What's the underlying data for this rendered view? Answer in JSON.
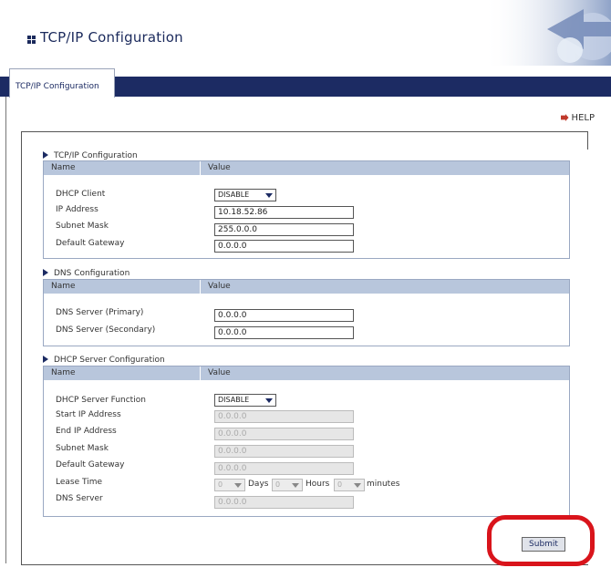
{
  "header": {
    "title": "TCP/IP Configuration"
  },
  "tabs": [
    {
      "label": "TCP/IP Configuration"
    }
  ],
  "help": {
    "label": "HELP"
  },
  "tcpip": {
    "title": "TCP/IP Configuration",
    "col_name": "Name",
    "col_value": "Value",
    "dhcp_client_label": "DHCP Client",
    "dhcp_client_value": "DISABLE",
    "ip_label": "IP Address",
    "ip_value": "10.18.52.86",
    "mask_label": "Subnet Mask",
    "mask_value": "255.0.0.0",
    "gateway_label": "Default Gateway",
    "gateway_value": "0.0.0.0"
  },
  "dns": {
    "title": "DNS Configuration",
    "col_name": "Name",
    "col_value": "Value",
    "primary_label": "DNS Server (Primary)",
    "primary_value": "0.0.0.0",
    "secondary_label": "DNS Server (Secondary)",
    "secondary_value": "0.0.0.0"
  },
  "dhcp_server": {
    "title": "DHCP Server Configuration",
    "col_name": "Name",
    "col_value": "Value",
    "function_label": "DHCP Server Function",
    "function_value": "DISABLE",
    "start_label": "Start IP Address",
    "start_value": "0.0.0.0",
    "end_label": "End IP Address",
    "end_value": "0.0.0.0",
    "mask_label": "Subnet Mask",
    "mask_value": "0.0.0.0",
    "gateway_label": "Default Gateway",
    "gateway_value": "0.0.0.0",
    "lease_label": "Lease Time",
    "lease_days": "0",
    "days_text": "Days",
    "lease_hours": "0",
    "hours_text": "Hours",
    "lease_minutes": "0",
    "minutes_text": "minutes",
    "dns_label": "DNS Server",
    "dns_value": "0.0.0.0"
  },
  "submit": {
    "label": "Submit"
  },
  "colors": {
    "nav": "#1c2b63",
    "header_row": "#b8c6dc",
    "highlight": "#d9141b"
  }
}
